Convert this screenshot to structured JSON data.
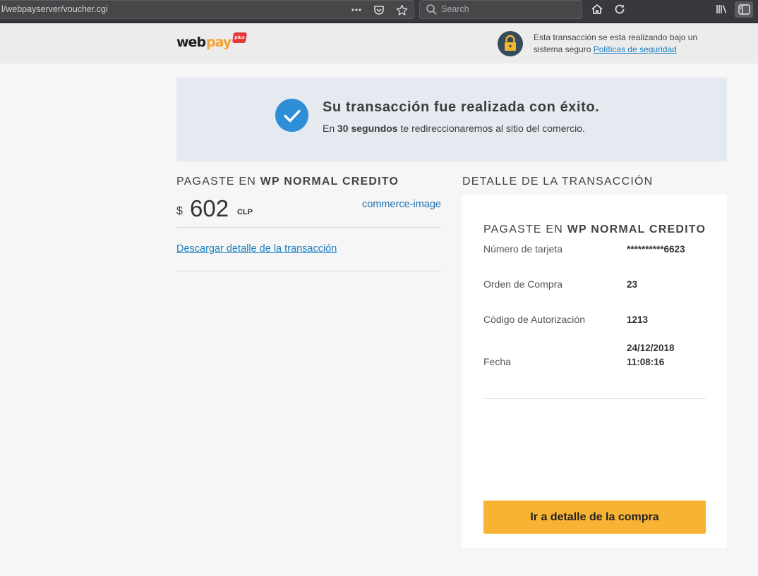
{
  "browser": {
    "url": "l/webpayserver/voucher.cgi",
    "search_placeholder": "Search"
  },
  "header": {
    "logo_web": "web",
    "logo_pay": "pay",
    "logo_plus": "plus",
    "secure_text": "Esta transacción se esta realizando bajo un sistema seguro",
    "secure_link": "Políticas de seguridad"
  },
  "banner": {
    "title": "Su transacción fue realizada con éxito.",
    "sub_prefix": "En",
    "sub_bold": "30 segundos",
    "sub_suffix": "te redireccionaremos al sitio del comercio."
  },
  "payment": {
    "title_prefix": "PAGASTE EN",
    "title_bold": "WP NORMAL CREDITO",
    "currency_symbol": "$",
    "amount": "602",
    "currency": "CLP",
    "commerce_image": "commerce-image",
    "download_link": "Descargar detalle de la transacción"
  },
  "details": {
    "section_title": "DETALLE DE LA TRANSACCIÓN",
    "card_title_prefix": "PAGASTE EN",
    "card_title_bold": "WP NORMAL CREDITO",
    "rows": [
      {
        "label": "Número de tarjeta",
        "value": "**********6623"
      },
      {
        "label": "Orden de Compra",
        "value": "23"
      },
      {
        "label": "Código de Autorización",
        "value": "1213"
      },
      {
        "label": "Fecha",
        "value": "24/12/2018",
        "value2": "11:08:16"
      }
    ],
    "cta_label": "Ir a detalle de la compra"
  },
  "colors": {
    "accent_blue": "#2f8fd6",
    "cta_yellow": "#f8b334",
    "link_blue": "#1a7fc1"
  }
}
